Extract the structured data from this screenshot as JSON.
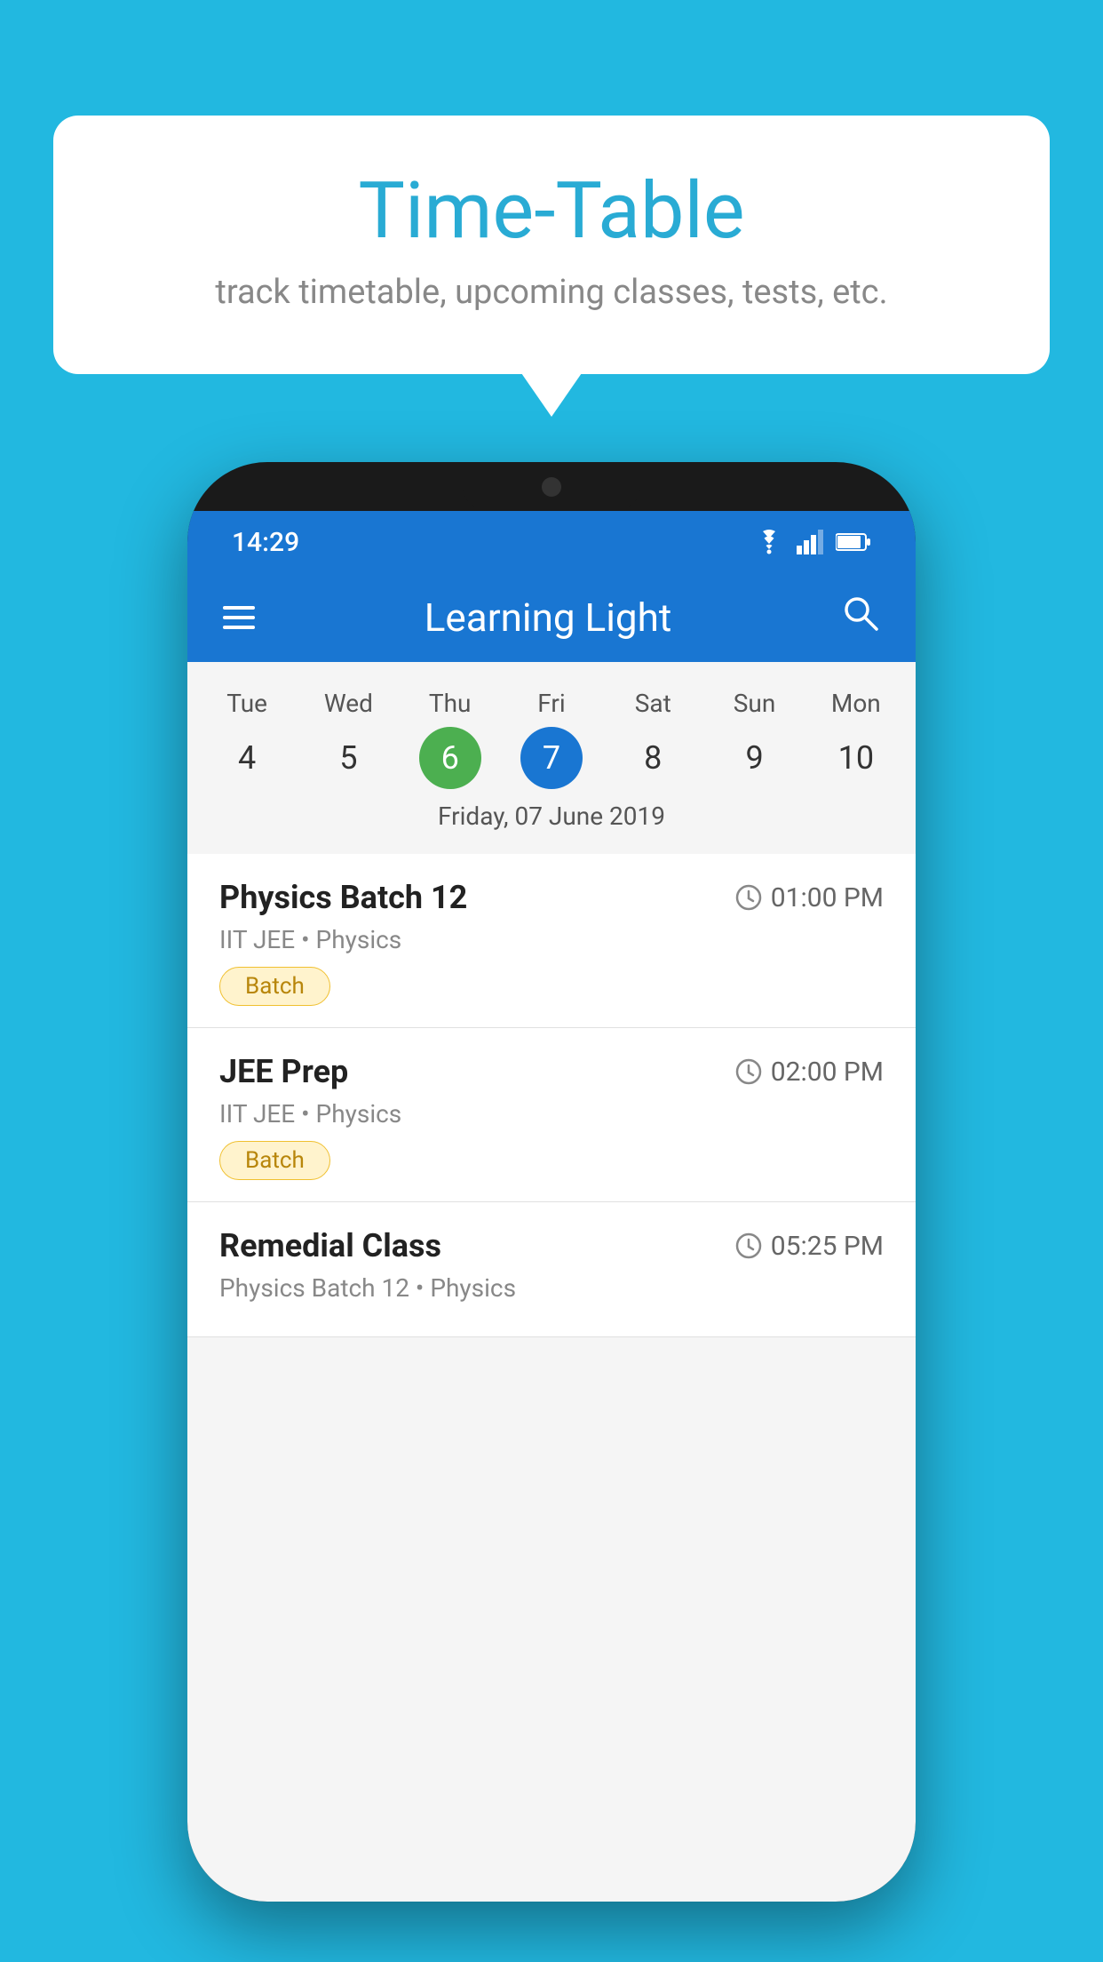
{
  "background_color": "#22B8E0",
  "speech_bubble": {
    "title": "Time-Table",
    "subtitle": "track timetable, upcoming classes, tests, etc."
  },
  "phone": {
    "status_bar": {
      "time": "14:29",
      "icons": [
        "wifi",
        "signal",
        "battery"
      ]
    },
    "app_header": {
      "title": "Learning Light",
      "menu_icon": "hamburger",
      "search_icon": "search"
    },
    "calendar": {
      "days": [
        "Tue",
        "Wed",
        "Thu",
        "Fri",
        "Sat",
        "Sun",
        "Mon"
      ],
      "dates": [
        "4",
        "5",
        "6",
        "7",
        "8",
        "9",
        "10"
      ],
      "today_index": 2,
      "selected_index": 3,
      "selected_date_label": "Friday, 07 June 2019"
    },
    "schedule_items": [
      {
        "title": "Physics Batch 12",
        "time": "01:00 PM",
        "subtitle": "IIT JEE • Physics",
        "tag": "Batch"
      },
      {
        "title": "JEE Prep",
        "time": "02:00 PM",
        "subtitle": "IIT JEE • Physics",
        "tag": "Batch"
      },
      {
        "title": "Remedial Class",
        "time": "05:25 PM",
        "subtitle": "Physics Batch 12 • Physics",
        "tag": null
      }
    ]
  }
}
